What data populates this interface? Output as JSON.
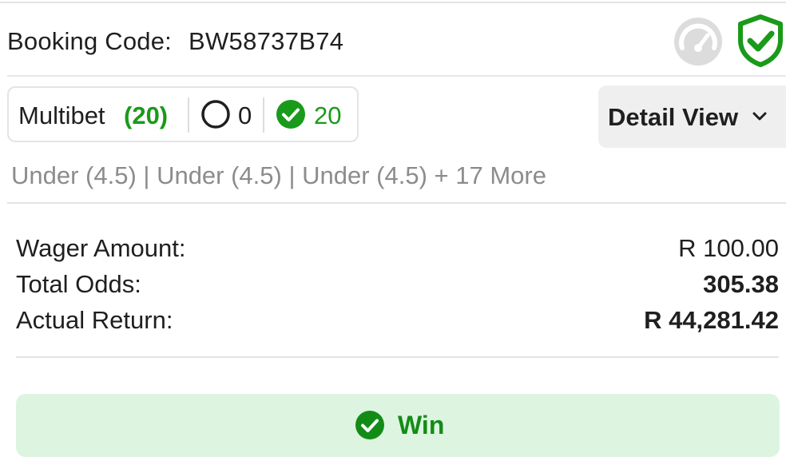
{
  "booking": {
    "label": "Booking Code:",
    "code": "BW58737B74"
  },
  "icons": {
    "speedometer": "speedometer-icon",
    "shield": "shield-check-icon",
    "open_circle": "circle-outline-icon",
    "won_check": "check-circle-icon",
    "chevron": "chevron-down-icon"
  },
  "multibet": {
    "label": "Multibet",
    "count": "(20)",
    "open_count": "0",
    "won_count": "20"
  },
  "detail_view": {
    "label": "Detail View"
  },
  "selections_summary": "Under (4.5) | Under (4.5) | Under (4.5)  + 17 More",
  "summary": {
    "wager_label": "Wager Amount:",
    "wager_value": "R 100.00",
    "odds_label": "Total Odds:",
    "odds_value": "305.38",
    "return_label": "Actual Return:",
    "return_value": "R 44,281.42"
  },
  "result": {
    "label": "Win"
  },
  "colors": {
    "green": "#1a9a1a",
    "win_bg": "#ddf5e0",
    "muted_text": "#8c8c8c",
    "icon_grey": "#dcdcdc"
  }
}
